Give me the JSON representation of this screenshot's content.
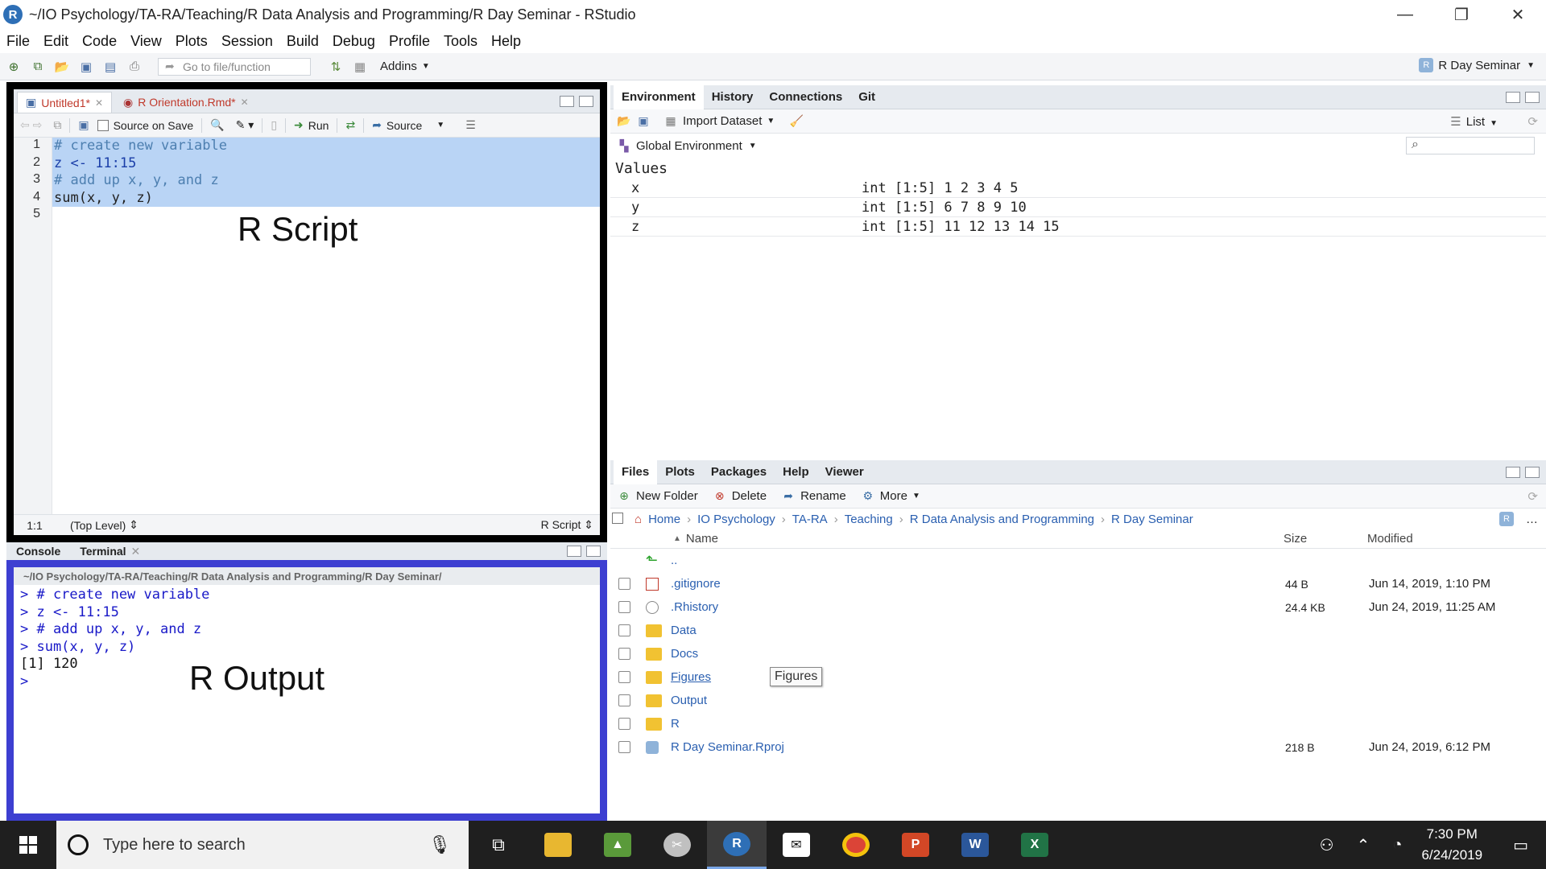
{
  "window": {
    "title": "~/IO Psychology/TA-RA/Teaching/R Data Analysis and Programming/R Day Seminar - RStudio"
  },
  "menu": [
    "File",
    "Edit",
    "Code",
    "View",
    "Plots",
    "Session",
    "Build",
    "Debug",
    "Profile",
    "Tools",
    "Help"
  ],
  "toolbar": {
    "goto_placeholder": "Go to file/function",
    "addins": "Addins",
    "project": "R Day Seminar"
  },
  "editor": {
    "tabs": [
      {
        "label": "Untitled1*"
      },
      {
        "label": "R Orientation.Rmd*"
      }
    ],
    "source_on_save": "Source on Save",
    "run": "Run",
    "source": "Source",
    "lines": [
      {
        "n": "1",
        "text": "# create new variable",
        "kind": "comment"
      },
      {
        "n": "2",
        "text": "z <- 11:15",
        "kind": "code"
      },
      {
        "n": "3",
        "text": "# add up x, y, and z",
        "kind": "comment"
      },
      {
        "n": "4",
        "text": "sum(x, y, z)",
        "kind": "code"
      },
      {
        "n": "5",
        "text": "",
        "kind": "code"
      }
    ],
    "annotation": "R Script",
    "status_pos": "1:1",
    "status_scope": "(Top Level)",
    "status_type": "R Script"
  },
  "console": {
    "tabs": [
      "Console",
      "Terminal"
    ],
    "path": "~/IO Psychology/TA-RA/Teaching/R Data Analysis and Programming/R Day Seminar/",
    "lines": [
      {
        "text": "> # create new variable",
        "kind": "in"
      },
      {
        "text": "> z <- 11:15",
        "kind": "in"
      },
      {
        "text": "> # add up x, y, and z",
        "kind": "in"
      },
      {
        "text": "> sum(x, y, z)",
        "kind": "in"
      },
      {
        "text": "[1] 120",
        "kind": "out"
      },
      {
        "text": "> ",
        "kind": "in"
      }
    ],
    "annotation": "R Output"
  },
  "env": {
    "tabs": [
      "Environment",
      "History",
      "Connections",
      "Git"
    ],
    "import_dataset": "Import Dataset",
    "list_view": "List",
    "scope": "Global Environment",
    "section": "Values",
    "rows": [
      {
        "name": "x",
        "value": "int [1:5] 1 2 3 4 5"
      },
      {
        "name": "y",
        "value": "int [1:5] 6 7 8 9 10"
      },
      {
        "name": "z",
        "value": "int [1:5] 11 12 13 14 15"
      }
    ]
  },
  "files": {
    "tabs": [
      "Files",
      "Plots",
      "Packages",
      "Help",
      "Viewer"
    ],
    "new_folder": "New Folder",
    "delete": "Delete",
    "rename": "Rename",
    "more": "More",
    "breadcrumb": [
      "Home",
      "IO Psychology",
      "TA-RA",
      "Teaching",
      "R Data Analysis and Programming",
      "R Day Seminar"
    ],
    "col_name": "Name",
    "col_size": "Size",
    "col_modified": "Modified",
    "rows": [
      {
        "name": "..",
        "size": "",
        "modified": "",
        "icon": "up"
      },
      {
        "name": ".gitignore",
        "size": "44 B",
        "modified": "Jun 14, 2019, 1:10 PM",
        "icon": "file"
      },
      {
        "name": ".Rhistory",
        "size": "24.4 KB",
        "modified": "Jun 24, 2019, 11:25 AM",
        "icon": "file"
      },
      {
        "name": "Data",
        "size": "",
        "modified": "",
        "icon": "folder"
      },
      {
        "name": "Docs",
        "size": "",
        "modified": "",
        "icon": "folder"
      },
      {
        "name": "Figures",
        "size": "",
        "modified": "",
        "icon": "folder"
      },
      {
        "name": "Output",
        "size": "",
        "modified": "",
        "icon": "folder"
      },
      {
        "name": "R",
        "size": "",
        "modified": "",
        "icon": "folder"
      },
      {
        "name": "R Day Seminar.Rproj",
        "size": "218 B",
        "modified": "Jun 24, 2019, 6:12 PM",
        "icon": "rproj"
      }
    ],
    "tooltip": "Figures"
  },
  "taskbar": {
    "search_placeholder": "Type here to search",
    "time": "7:30 PM",
    "date": "6/24/2019"
  }
}
